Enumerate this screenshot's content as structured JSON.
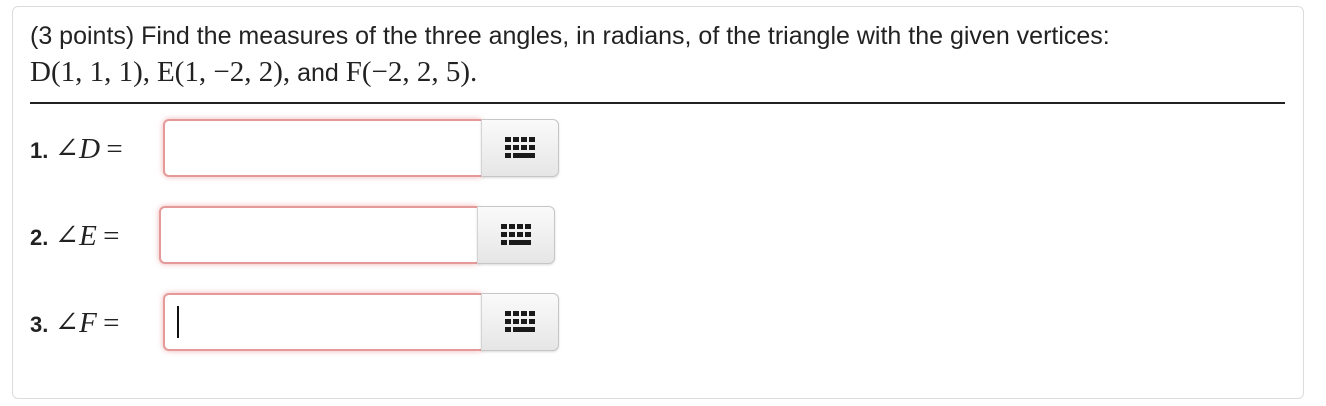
{
  "problem": {
    "intro": "(3 points) Find the measures of the three angles, in radians, of the triangle with the given vertices:",
    "vertex_d": "D(1, 1, 1),",
    "vertex_e": "E(1, −2, 2),",
    "and_word": "and",
    "vertex_f": "F(−2, 2, 5)."
  },
  "answers": [
    {
      "number": "1.",
      "angle_symbol": "∠",
      "vertex": "D",
      "equals": "=",
      "value": ""
    },
    {
      "number": "2.",
      "angle_symbol": "∠",
      "vertex": "E",
      "equals": "=",
      "value": ""
    },
    {
      "number": "3.",
      "angle_symbol": "∠",
      "vertex": "F",
      "equals": "=",
      "value": ""
    }
  ],
  "icons": {
    "palette": "math-palette-icon"
  },
  "colors": {
    "input_border": "#e59a9a",
    "text": "#222222"
  }
}
